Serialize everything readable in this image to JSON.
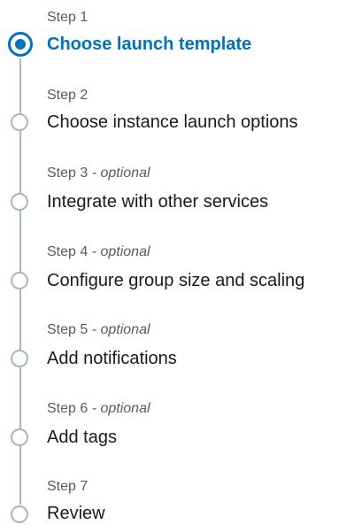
{
  "wizard": {
    "steps": [
      {
        "label": "Step 1",
        "optional": "",
        "title": "Choose launch template",
        "active": true
      },
      {
        "label": "Step 2",
        "optional": "",
        "title": "Choose instance launch options",
        "active": false
      },
      {
        "label": "Step 3",
        "optional": " - optional",
        "title": "Integrate with other services",
        "active": false
      },
      {
        "label": "Step 4",
        "optional": " - optional",
        "title": "Configure group size and scaling",
        "active": false
      },
      {
        "label": "Step 5",
        "optional": " - optional",
        "title": "Add notifications",
        "active": false
      },
      {
        "label": "Step 6",
        "optional": " - optional",
        "title": "Add tags",
        "active": false
      },
      {
        "label": "Step 7",
        "optional": "",
        "title": "Review",
        "active": false
      }
    ],
    "colors": {
      "accent": "#0073bb",
      "inactive": "#aab7b8",
      "label": "#545b64",
      "title": "#16191f"
    }
  }
}
